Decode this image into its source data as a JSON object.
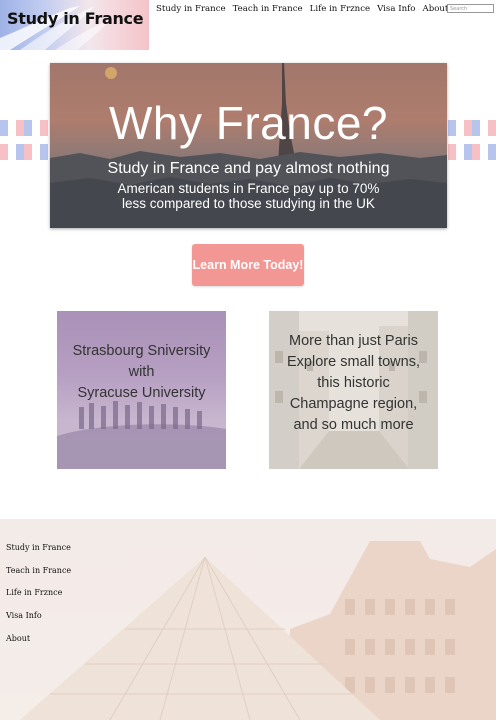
{
  "logo": {
    "text": "Study in France"
  },
  "nav": {
    "items": [
      "Study in France",
      "Teach in France",
      "Life in Frznce",
      "Visa Info",
      "About"
    ],
    "search_placeholder": "Search"
  },
  "hero": {
    "title": "Why France?",
    "subtitle": "Study in France and pay almost nothing",
    "line1": "American students in France pay up to 70%",
    "line2": "less compared to those studying in the UK"
  },
  "cta": {
    "label": "Learn More Today!"
  },
  "cards": [
    {
      "lines": [
        "Strasbourg Sniversity",
        "with",
        "Syracuse University"
      ]
    },
    {
      "lines": [
        "More than just Paris",
        "Explore small towns,",
        "this historic",
        "Champagne region,",
        "and so much more"
      ]
    }
  ],
  "footer": {
    "links": [
      "Study in France",
      "Teach in France",
      "Life in Frznce",
      "Visa Info",
      "About"
    ]
  },
  "colors": {
    "flag_blue": "#b7c5ee",
    "flag_red": "#f6c0c5",
    "cta": "#f29794"
  }
}
